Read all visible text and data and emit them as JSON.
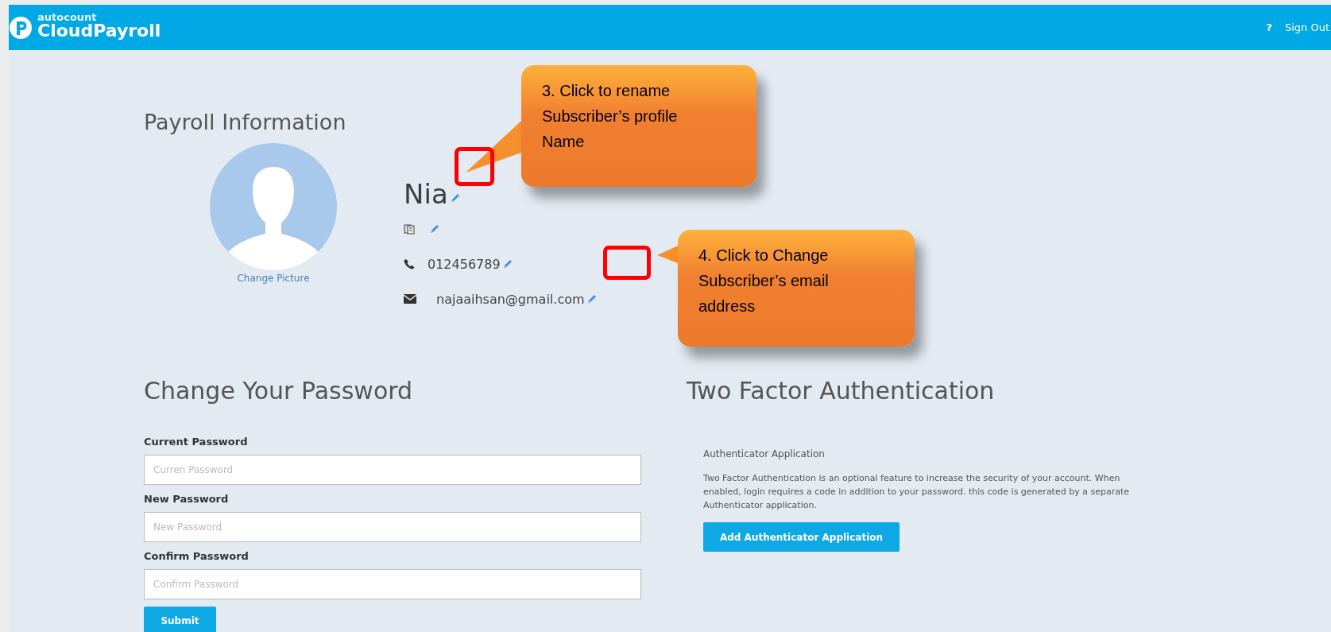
{
  "header": {
    "logo_small": "autocount",
    "logo_main": "CloudPayroll",
    "help": "?",
    "sign_out": "Sign Out"
  },
  "profile": {
    "title": "Payroll Information",
    "change_picture": "Change Picture",
    "name": "Nia",
    "phone": "012456789",
    "email": "najaaihsan@gmail.com"
  },
  "password": {
    "title": "Change Your Password",
    "fields": [
      {
        "label": "Current Password",
        "placeholder": "Curren Password"
      },
      {
        "label": "New Password",
        "placeholder": "New Password"
      },
      {
        "label": "Confirm Password",
        "placeholder": "Confirm Password"
      }
    ],
    "submit": "Submit"
  },
  "two_factor": {
    "title": "Two Factor Authentication",
    "subtitle": "Authenticator Application",
    "description": "Two Factor Authentication is an optional feature to increase the security of your account. When enabled, login requires a code in addition to your password. this code is generated by a separate Authenticator application.",
    "button": "Add Authenticator Application"
  },
  "callouts": [
    {
      "text": "3. Click to rename Subscriber’s profile Name"
    },
    {
      "text": "4. Click to Change Subscriber’s email address"
    }
  ]
}
